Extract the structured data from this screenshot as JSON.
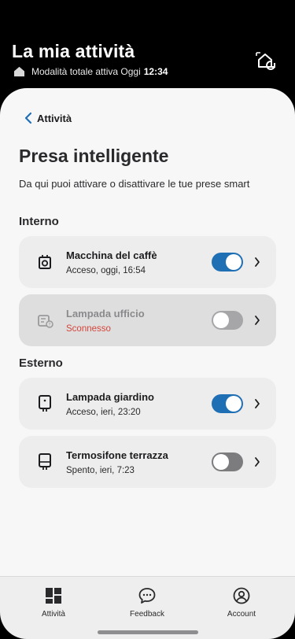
{
  "header": {
    "title": "La mia attività",
    "mode_text": "Modalità totale attiva Oggi",
    "time": "12:34"
  },
  "nav": {
    "back_label": "Attività"
  },
  "page": {
    "title": "Presa intelligente",
    "description": "Da qui puoi attivare o disattivare le tue prese smart"
  },
  "sections": {
    "interno": "Interno",
    "esterno": "Esterno"
  },
  "devices": [
    {
      "name": "Macchina del caffè",
      "status": "Acceso, oggi, 16:54",
      "on": true,
      "icon": "coffee-machine-icon"
    },
    {
      "name": "Lampada ufficio",
      "status": "Sconnesso",
      "on": false,
      "icon": "lamp-disconnected-icon"
    },
    {
      "name": "Lampada giardino",
      "status": "Acceso, ieri, 23:20",
      "on": true,
      "icon": "plug-icon"
    },
    {
      "name": "Termosifone terrazza",
      "status": "Spento, ieri, 7:23",
      "on": false,
      "icon": "heater-plug-icon"
    }
  ],
  "tabs": [
    {
      "label": "Attività",
      "icon": "dashboard-icon",
      "active": true
    },
    {
      "label": "Feedback",
      "icon": "chat-bubble-icon",
      "active": false
    },
    {
      "label": "Account",
      "icon": "user-icon",
      "active": false
    }
  ],
  "colors": {
    "accent": "#1f6fb5",
    "error": "#d6453a",
    "header_bg": "#000000",
    "sheet_bg": "#f8f7f8"
  }
}
